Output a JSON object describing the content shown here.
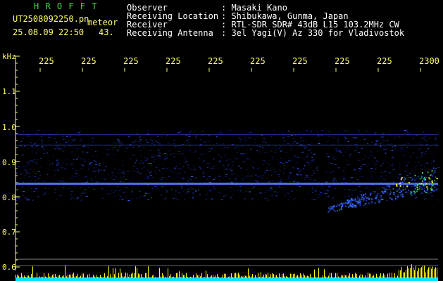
{
  "header": {
    "brand": "H R O F F T",
    "filename": "UT2508092250.pn",
    "mode": "meteor",
    "datetime": "25.08.09 22:50",
    "count": "43.",
    "fields": [
      {
        "label": "Observer",
        "value": ": Masaki Kano"
      },
      {
        "label": "Receiving Location",
        "value": ": Shibukawa, Gunma, Japan"
      },
      {
        "label": "Receiver",
        "value": ": RTL-SDR SDR# 43dB L15 103.2MHz CW"
      },
      {
        "label": "Receiving Antenna",
        "value": ": 3el Yagi(V) Az 330 for Vladivostok"
      }
    ]
  },
  "axis": {
    "y_unit": "kHz",
    "y_ticks": [
      "1.1",
      "1.0",
      "0.9",
      "0.8",
      "0.7",
      "0.6"
    ],
    "x_ticks": [
      "225",
      "225",
      "225",
      "225",
      "225",
      "225",
      "225",
      "225",
      "225",
      "2300"
    ]
  },
  "colors": {
    "background": "#000000",
    "label": "#ffff66",
    "brand": "#44dd44",
    "trace": "#4a6cff",
    "echo": "#33ff66",
    "bottom_bar": "#ffff00",
    "bottom_base": "#00e5ff"
  }
}
